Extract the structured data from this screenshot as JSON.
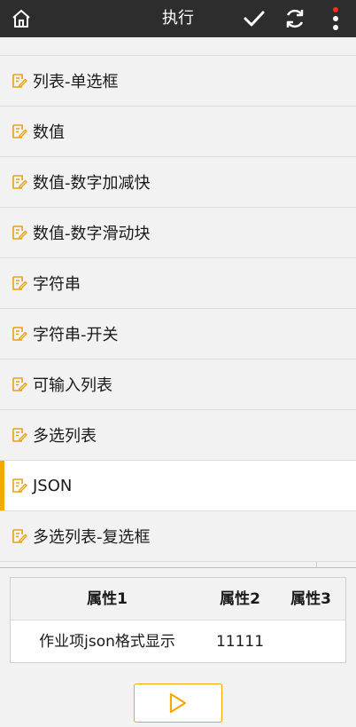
{
  "header": {
    "title": "执行"
  },
  "list": {
    "items": [
      {
        "label": "列表-单选框",
        "active": false
      },
      {
        "label": "数值",
        "active": false
      },
      {
        "label": "数值-数字加减快",
        "active": false
      },
      {
        "label": "数值-数字滑动块",
        "active": false
      },
      {
        "label": "字符串",
        "active": false
      },
      {
        "label": "字符串-开关",
        "active": false
      },
      {
        "label": "可输入列表",
        "active": false
      },
      {
        "label": "多选列表",
        "active": false
      },
      {
        "label": "JSON",
        "active": true
      },
      {
        "label": "多选列表-复选框",
        "active": false
      }
    ],
    "item_icon": "edit-note-icon"
  },
  "table": {
    "headers": [
      "属性1",
      "属性2",
      "属性3"
    ],
    "rows": [
      [
        "作业项json格式显示",
        "11111",
        ""
      ]
    ]
  },
  "colors": {
    "topbar": "#2d2d2d",
    "accent": "#f2a900",
    "background": "#f2f2f2"
  },
  "icons": {
    "home": "home-icon",
    "confirm": "check-icon",
    "refresh": "refresh-icon",
    "more": "more-vertical-icon",
    "play": "play-icon"
  }
}
